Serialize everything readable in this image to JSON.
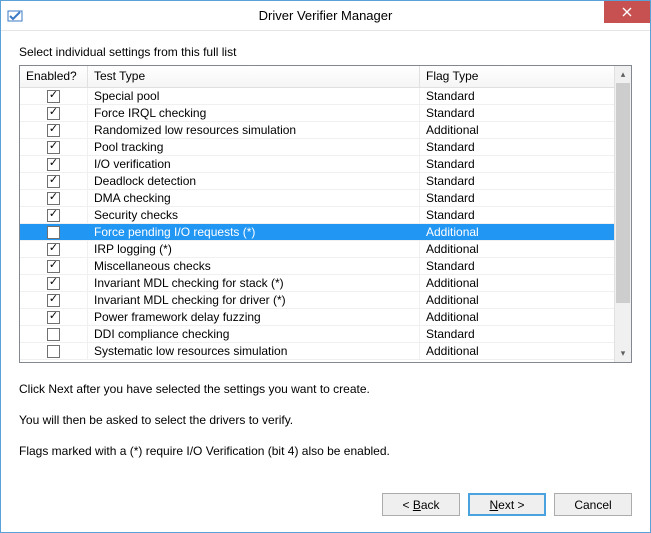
{
  "window": {
    "title": "Driver Verifier Manager",
    "icon": "verifier-app-icon"
  },
  "instruction": "Select individual settings from this full list",
  "columns": {
    "enabled": "Enabled?",
    "testType": "Test Type",
    "flagType": "Flag Type"
  },
  "rows": [
    {
      "enabled": true,
      "testType": "Special pool",
      "flagType": "Standard",
      "selected": false
    },
    {
      "enabled": true,
      "testType": "Force IRQL checking",
      "flagType": "Standard",
      "selected": false
    },
    {
      "enabled": true,
      "testType": "Randomized low resources simulation",
      "flagType": "Additional",
      "selected": false
    },
    {
      "enabled": true,
      "testType": "Pool tracking",
      "flagType": "Standard",
      "selected": false
    },
    {
      "enabled": true,
      "testType": "I/O verification",
      "flagType": "Standard",
      "selected": false
    },
    {
      "enabled": true,
      "testType": "Deadlock detection",
      "flagType": "Standard",
      "selected": false
    },
    {
      "enabled": true,
      "testType": "DMA checking",
      "flagType": "Standard",
      "selected": false
    },
    {
      "enabled": true,
      "testType": "Security checks",
      "flagType": "Standard",
      "selected": false
    },
    {
      "enabled": false,
      "testType": "Force pending I/O requests (*)",
      "flagType": "Additional",
      "selected": true
    },
    {
      "enabled": true,
      "testType": "IRP logging (*)",
      "flagType": "Additional",
      "selected": false
    },
    {
      "enabled": true,
      "testType": "Miscellaneous checks",
      "flagType": "Standard",
      "selected": false
    },
    {
      "enabled": true,
      "testType": "Invariant MDL checking for stack (*)",
      "flagType": "Additional",
      "selected": false
    },
    {
      "enabled": true,
      "testType": "Invariant MDL checking for driver (*)",
      "flagType": "Additional",
      "selected": false
    },
    {
      "enabled": true,
      "testType": "Power framework delay fuzzing",
      "flagType": "Additional",
      "selected": false
    },
    {
      "enabled": false,
      "testType": "DDI compliance checking",
      "flagType": "Standard",
      "selected": false
    },
    {
      "enabled": false,
      "testType": "Systematic low resources simulation",
      "flagType": "Additional",
      "selected": false
    }
  ],
  "footer": {
    "line1": "Click Next after you have selected the settings you want to create.",
    "line2": "You will then be asked to select the drivers to verify.",
    "line3": "Flags marked with a (*) require I/O Verification (bit 4) also be enabled."
  },
  "buttons": {
    "back": "Back",
    "next": "Next >",
    "cancel": "Cancel"
  }
}
